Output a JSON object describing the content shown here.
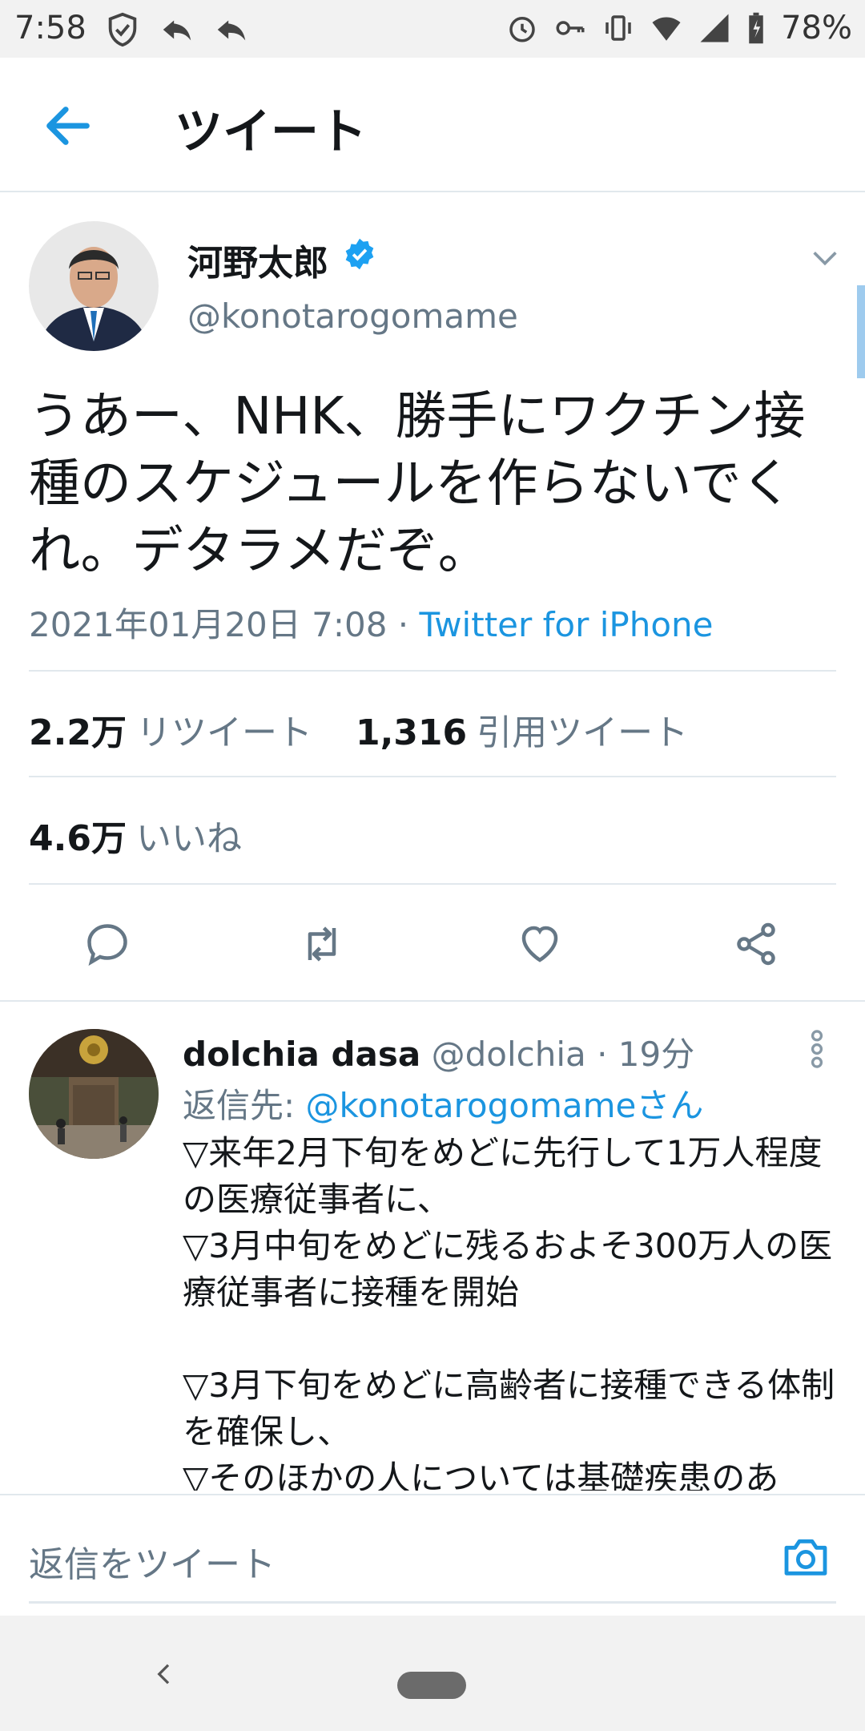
{
  "status_bar": {
    "time": "7:58",
    "battery": "78%",
    "left_icons": [
      "shield-check-icon",
      "reply-arrow-icon",
      "reply-arrow-icon"
    ],
    "right_icons": [
      "alarm-icon",
      "key-icon",
      "vibrate-icon",
      "wifi-icon",
      "signal-icon",
      "battery-icon"
    ]
  },
  "header": {
    "title": "ツイート",
    "back_icon": "back-arrow-icon"
  },
  "tweet": {
    "author_name": "河野太郎",
    "author_handle": "@konotarogomame",
    "text": "うあー、NHK、勝手にワクチン接種のスケジュールを作らないでくれ。デタラメだぞ。",
    "timestamp": "2021年01月20日 7:08 · ",
    "source": "Twitter for iPhone",
    "retweets_count": "2.2万",
    "retweets_label": "リツイート",
    "quotes_count": "1,316",
    "quotes_label": "引用ツイート",
    "likes_count": "4.6万",
    "likes_label": "いいね"
  },
  "actions": [
    "reply-icon",
    "retweet-icon",
    "like-icon",
    "share-icon"
  ],
  "reply": {
    "name": "dolchia dasa",
    "handle_time": "@dolchia · 19分",
    "reply_to_prefix": "返信先: ",
    "reply_to_mention": "@konotarogomameさん",
    "lines": [
      "▽来年2月下旬をめどに先行して1万人程度の医療従事者に、",
      "▽3月中旬をめどに残るおよそ300万人の医療従事者に接種を開始",
      "",
      "▽3月下旬をめどに高齢者に接種できる体制を確保し、",
      "▽そのほかの人については基礎疾患のあ"
    ]
  },
  "composer": {
    "placeholder": "返信をツイート"
  },
  "colors": {
    "accent": "#1b95e0",
    "secondary_text": "#657786",
    "divider": "#e1e8ed"
  }
}
